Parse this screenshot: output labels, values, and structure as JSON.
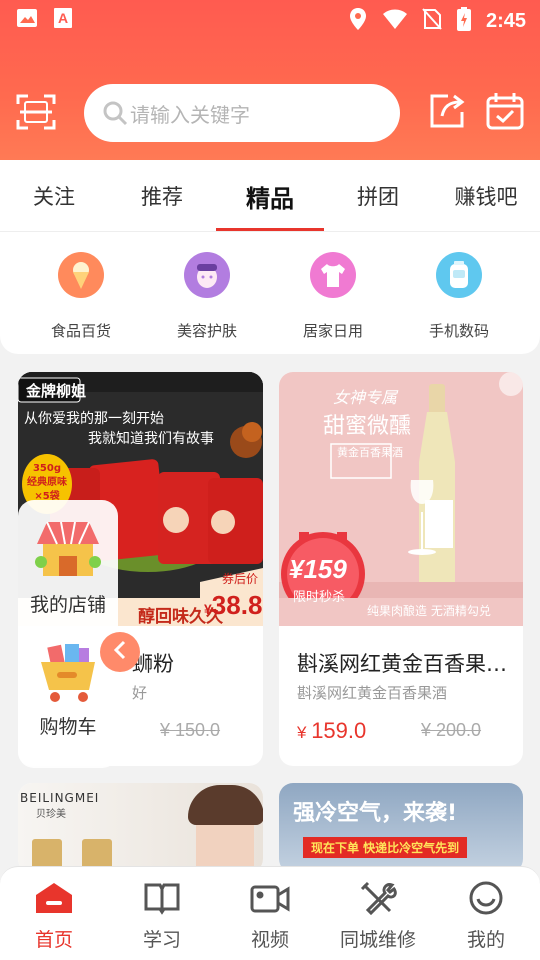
{
  "statusbar": {
    "time": "2:45"
  },
  "search": {
    "placeholder": "请输入关键字"
  },
  "tabs": [
    {
      "label": "关注",
      "active": false
    },
    {
      "label": "推荐",
      "active": false
    },
    {
      "label": "精品",
      "active": true
    },
    {
      "label": "拼团",
      "active": false
    },
    {
      "label": "赚钱吧",
      "active": false
    }
  ],
  "categories": [
    {
      "label": "食品百货",
      "icon": "ice-cream-icon",
      "color": "#ff8a5c"
    },
    {
      "label": "美容护肤",
      "icon": "face-mask-icon",
      "color": "#b27de0"
    },
    {
      "label": "居家日用",
      "icon": "tshirt-icon",
      "color": "#f07ad2"
    },
    {
      "label": "手机数码",
      "icon": "device-icon",
      "color": "#5fc8ef"
    }
  ],
  "products": [
    {
      "title": "金牌柳姐螺蛳粉",
      "visible_title": "蛳粉",
      "subtitle": "好",
      "price": "150.0",
      "old_price": "¥ 150.0",
      "image_texts": {
        "brand": "金牌柳姐",
        "line1": "从你爱我的那一刻开始",
        "line2": "我就知道我们有故事",
        "badge_weight": "350g",
        "badge_desc": "经典原味",
        "badge_count": "×5袋",
        "coupon_label": "券后价",
        "coupon_price": "38.8",
        "slogan": "醇回味久久"
      }
    },
    {
      "title": "斟溪网红黄金百香果…",
      "subtitle": "斟溪网红黄金百香果酒",
      "price": "159.0",
      "old_price": "¥ 200.0",
      "image_texts": {
        "top1": "女神专属",
        "top2": "甜蜜微醺",
        "tag": "黄金百香果酒",
        "price_big": "¥159",
        "limit": "限时秒杀",
        "footer": "纯果肉酿造 无酒精勾兑"
      }
    }
  ],
  "bottom_cards": [
    {
      "brand": "BEILINGMEI",
      "brand_cn": "贝珍美"
    },
    {
      "headline": "强冷空气，来袭!",
      "ribbon": "现在下单 快递比冷空气先到"
    }
  ],
  "float_panel": {
    "shop_label": "我的店铺",
    "cart_label": "购物车"
  },
  "bottom_nav": [
    {
      "label": "首页",
      "icon": "home-icon",
      "active": true
    },
    {
      "label": "学习",
      "icon": "book-icon",
      "active": false
    },
    {
      "label": "视频",
      "icon": "video-icon",
      "active": false
    },
    {
      "label": "同城维修",
      "icon": "tools-icon",
      "active": false
    },
    {
      "label": "我的",
      "icon": "smile-icon",
      "active": false
    }
  ],
  "colors": {
    "accent": "#e8352c",
    "header": "#ff5b50"
  }
}
